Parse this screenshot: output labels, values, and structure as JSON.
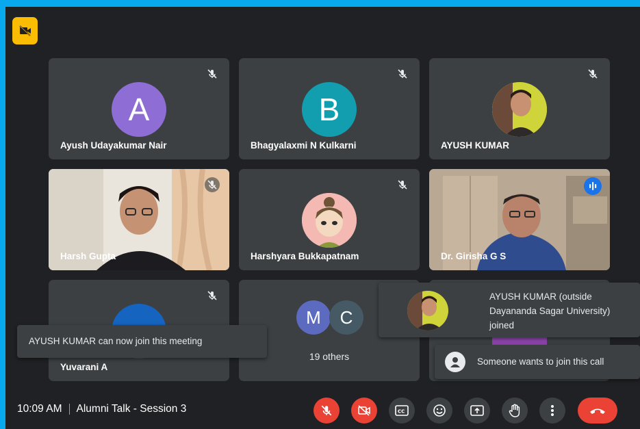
{
  "tiles": [
    {
      "name": "Ayush Udayakumar Nair",
      "avatar_letter": "A",
      "avatar_color": "#8e6ed4"
    },
    {
      "name": "Bhagyalaxmi N Kulkarni",
      "avatar_letter": "B",
      "avatar_color": "#129eaf"
    },
    {
      "name": "AYUSH KUMAR"
    },
    {
      "name": "Harsh Gupta"
    },
    {
      "name": "Harshyara Bukkapatnam"
    },
    {
      "name": "Dr. Girisha G S"
    },
    {
      "name": "Yuvarani A"
    }
  ],
  "others": {
    "letters": [
      "M",
      "C"
    ],
    "label": "19 others",
    "colors": [
      "#5c6bc0",
      "#455a64"
    ]
  },
  "notifications": {
    "can_join": "AYUSH KUMAR can now join this meeting",
    "joined": "AYUSH KUMAR (outside Dayananda Sagar University) joined",
    "wants_join": "Someone wants to join this call"
  },
  "meeting": {
    "time": "10:09 AM",
    "title": "Alumni Talk - Session 3"
  },
  "controls": [
    "mic-off",
    "camera-off",
    "captions",
    "reactions",
    "present",
    "raise-hand",
    "more-options",
    "leave-call"
  ],
  "colors": {
    "accent": "#1a73e8",
    "danger": "#ea4335",
    "tile": "#3c4043",
    "background": "#202124",
    "recording": "#fbbc04"
  }
}
